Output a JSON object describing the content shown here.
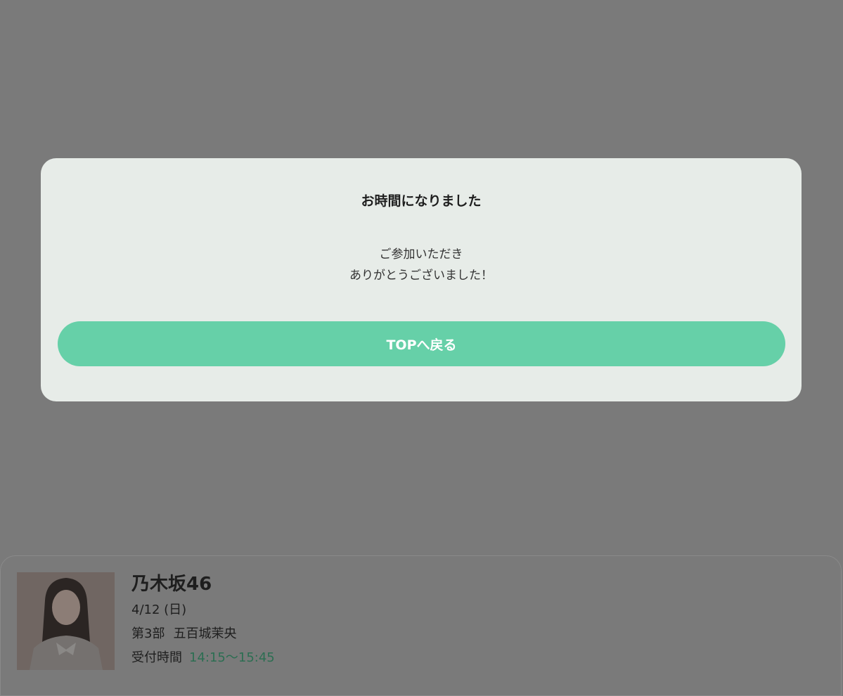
{
  "modal": {
    "title": "お時間になりました",
    "message_line1": "ご参加いただき",
    "message_line2": "ありがとうございました！",
    "button_label": "TOPへ戻る"
  },
  "event_card": {
    "group_name": "乃木坂46",
    "date": "4/12 (日)",
    "session_label": "第3部",
    "member_name": "五百城茉央",
    "reception_label": "受付時間",
    "reception_time": "14:15〜15:45"
  },
  "colors": {
    "overlay_background": "#7a7a7a",
    "modal_background": "#e7ece8",
    "accent_button": "#66d0a8",
    "reception_time_text": "#2c6e52"
  }
}
